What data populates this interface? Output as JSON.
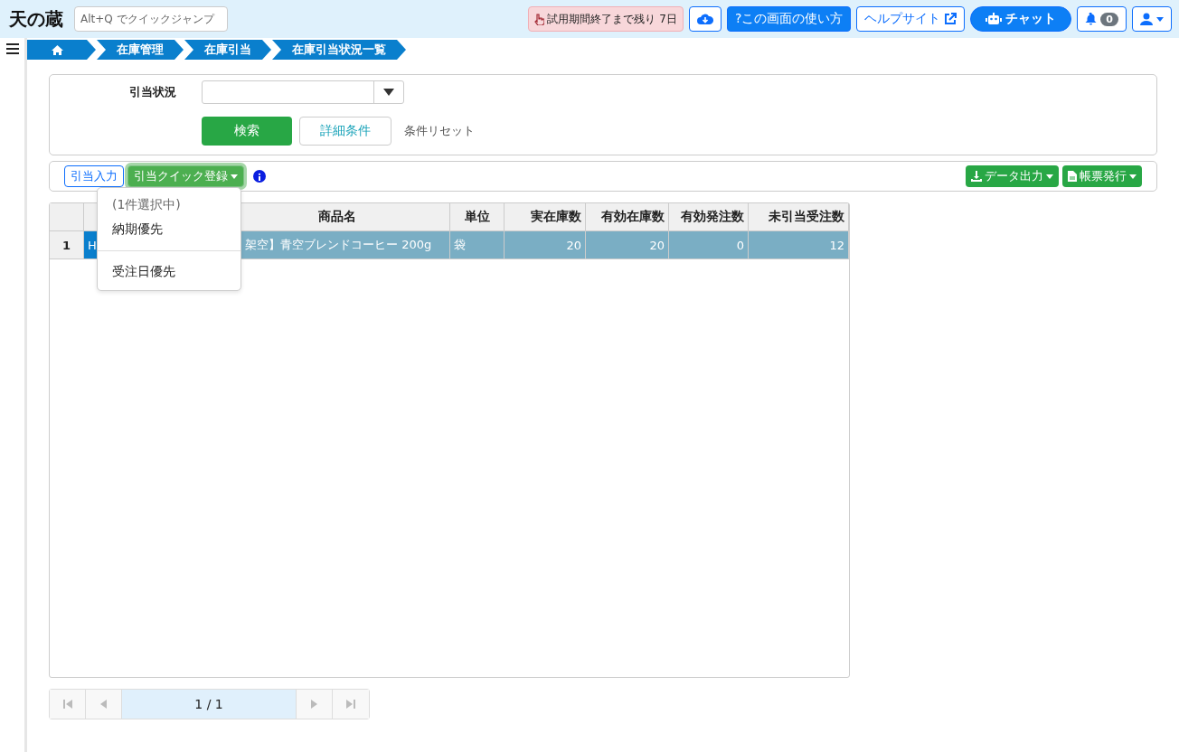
{
  "header": {
    "logo": "天の蔵",
    "jump_placeholder": "Alt+Q でクイックジャンプ",
    "trial_badge": "試用期間終了まで残り 7日",
    "usage_button": "?この画面の使い方",
    "help_button": "ヘルプサイト",
    "chat_button": "チャット",
    "notification_count": "0"
  },
  "breadcrumb": [
    "在庫管理",
    "在庫引当",
    "在庫引当状況一覧"
  ],
  "filter": {
    "label": "引当状況",
    "search_button": "検索",
    "detail_button": "詳細条件",
    "reset_link": "条件リセット"
  },
  "toolbar": {
    "left": [
      {
        "label": "引当入力",
        "kind": "outline"
      },
      {
        "label": "引当クイック登録",
        "kind": "dropdown"
      }
    ],
    "right": [
      {
        "label": "データ出力",
        "kind": "download"
      },
      {
        "label": "帳票発行",
        "kind": "document"
      }
    ]
  },
  "dropdown_menu": {
    "header": "(1件選択中)",
    "items": [
      "納期優先",
      "受注日優先"
    ]
  },
  "table": {
    "columns": [
      "",
      "",
      "商品名",
      "単位",
      "実在庫数",
      "有効在庫数",
      "有効発注数",
      "未引当受注数"
    ],
    "rows": [
      {
        "selected": true,
        "cells": [
          "1",
          "H",
          "架空】青空ブレンドコーヒー 200g",
          "袋",
          "20",
          "20",
          "0",
          "12"
        ]
      }
    ]
  },
  "pager": {
    "page": "1 / 1"
  }
}
